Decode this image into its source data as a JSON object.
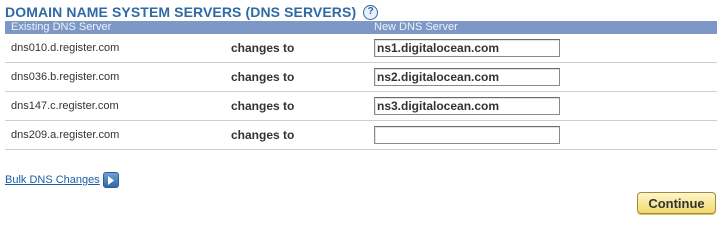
{
  "header": {
    "title": "DOMAIN NAME SYSTEM SERVERS (DNS SERVERS)",
    "help_icon": "question-mark-icon",
    "help_glyph": "?"
  },
  "table": {
    "columns": {
      "existing": "Existing DNS Server",
      "changes": "",
      "new": "New DNS Server"
    },
    "rows": [
      {
        "existing": "dns010.d.register.com",
        "changes": "changes to",
        "new_value": "ns1.digitalocean.com"
      },
      {
        "existing": "dns036.b.register.com",
        "changes": "changes to",
        "new_value": "ns2.digitalocean.com"
      },
      {
        "existing": "dns147.c.register.com",
        "changes": "changes to",
        "new_value": "ns3.digitalocean.com"
      },
      {
        "existing": "dns209.a.register.com",
        "changes": "changes to",
        "new_value": ""
      }
    ]
  },
  "bulk": {
    "link_label": "Bulk DNS Changes",
    "icon": "arrow-right-icon"
  },
  "actions": {
    "continue_label": "Continue"
  },
  "colors": {
    "title": "#2f6aa6",
    "table_header_bg": "#7d98c6",
    "link": "#1b5ea8",
    "button_gradient_top": "#fff6cc",
    "button_gradient_bottom": "#f1d86b"
  }
}
